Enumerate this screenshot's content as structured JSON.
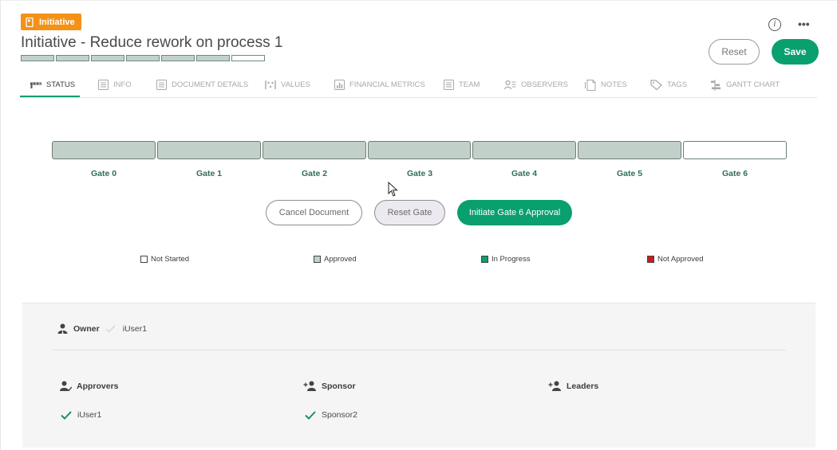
{
  "header": {
    "badge_label": "Initiative",
    "title": "Initiative - Reduce rework on process 1",
    "progress_segments": [
      "approved",
      "approved",
      "approved",
      "approved",
      "approved",
      "approved",
      "not-started"
    ],
    "info_icon": "info-icon",
    "more_icon": "more-horizontal-icon",
    "reset_label": "Reset",
    "save_label": "Save"
  },
  "tabs": [
    {
      "label": "STATUS",
      "icon": "status-gates-icon",
      "active": true
    },
    {
      "label": "INFO",
      "icon": "info-list-icon"
    },
    {
      "label": "DOCUMENT DETAILS",
      "icon": "document-details-icon"
    },
    {
      "label": "VALUES",
      "icon": "values-icon"
    },
    {
      "label": "FINANCIAL METRICS",
      "icon": "financial-metrics-icon"
    },
    {
      "label": "TEAM",
      "icon": "team-icon"
    },
    {
      "label": "OBSERVERS",
      "icon": "observers-icon"
    },
    {
      "label": "NOTES",
      "icon": "notes-icon"
    },
    {
      "label": "TAGS",
      "icon": "tags-icon"
    },
    {
      "label": "GANTT CHART",
      "icon": "gantt-chart-icon"
    }
  ],
  "gates": [
    {
      "label": "Gate 0",
      "status": "Approved"
    },
    {
      "label": "Gate 1",
      "status": "Approved"
    },
    {
      "label": "Gate 2",
      "status": "Approved"
    },
    {
      "label": "Gate 3",
      "status": "Approved"
    },
    {
      "label": "Gate 4",
      "status": "Approved"
    },
    {
      "label": "Gate 5",
      "status": "Approved"
    },
    {
      "label": "Gate 6",
      "status": "Not Started"
    }
  ],
  "actions": {
    "cancel_document": "Cancel Document",
    "reset_gate": "Reset Gate",
    "initiate_approval": "Initiate Gate 6 Approval"
  },
  "legend": [
    {
      "label": "Not Started",
      "color": "#ffffff"
    },
    {
      "label": "Approved",
      "color": "#c3d0ca"
    },
    {
      "label": "In Progress",
      "color": "#0a9f6e"
    },
    {
      "label": "Not Approved",
      "color": "#c41d1d"
    }
  ],
  "people": {
    "owner_label": "Owner",
    "owner_value": "iUser1",
    "approvers_label": "Approvers",
    "approvers": [
      "iUser1"
    ],
    "sponsor_label": "Sponsor",
    "sponsors": [
      "Sponsor2"
    ],
    "leaders_label": "Leaders"
  },
  "colors": {
    "accent": "#0a9f6e",
    "badge": "#f39217",
    "gate_label": "#2f6e57"
  }
}
